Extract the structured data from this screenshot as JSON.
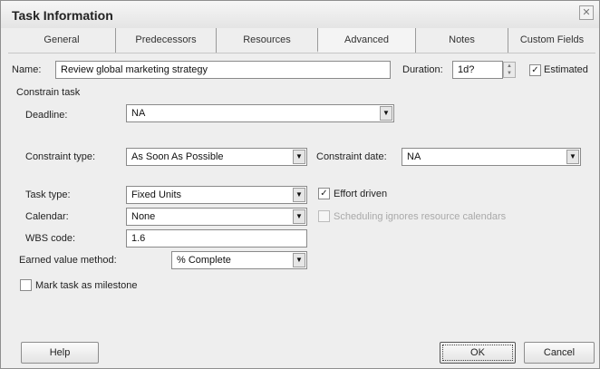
{
  "window": {
    "title": "Task Information"
  },
  "tabs": [
    {
      "label": "General"
    },
    {
      "label": "Predecessors"
    },
    {
      "label": "Resources"
    },
    {
      "label": "Advanced",
      "active": true
    },
    {
      "label": "Notes"
    },
    {
      "label": "Custom Fields"
    }
  ],
  "name": {
    "label": "Name:",
    "value": "Review global marketing strategy"
  },
  "duration": {
    "label": "Duration:",
    "value": "1d?"
  },
  "estimated": {
    "label": "Estimated",
    "checked": true
  },
  "constrain_task": {
    "heading": "Constrain task",
    "deadline_label": "Deadline:",
    "deadline_value": "NA",
    "constraint_type_label": "Constraint type:",
    "constraint_type_value": "As Soon As Possible",
    "constraint_date_label": "Constraint date:",
    "constraint_date_value": "NA"
  },
  "task_type": {
    "label": "Task type:",
    "value": "Fixed Units"
  },
  "effort_driven": {
    "label": "Effort driven",
    "checked": true
  },
  "calendar": {
    "label": "Calendar:",
    "value": "None"
  },
  "scheduling_ignores": {
    "label": "Scheduling ignores resource calendars",
    "checked": false,
    "enabled": false
  },
  "wbs": {
    "label": "WBS code:",
    "value": "1.6"
  },
  "earned_value": {
    "label": "Earned value method:",
    "value": "% Complete"
  },
  "milestone": {
    "label": "Mark task as milestone",
    "checked": false
  },
  "buttons": {
    "help": "Help",
    "ok": "OK",
    "cancel": "Cancel"
  },
  "icons": {
    "close": "close-icon",
    "dropdown": "chevron-down-icon",
    "spinner": "spinner-icon",
    "check": "checkmark-icon"
  }
}
